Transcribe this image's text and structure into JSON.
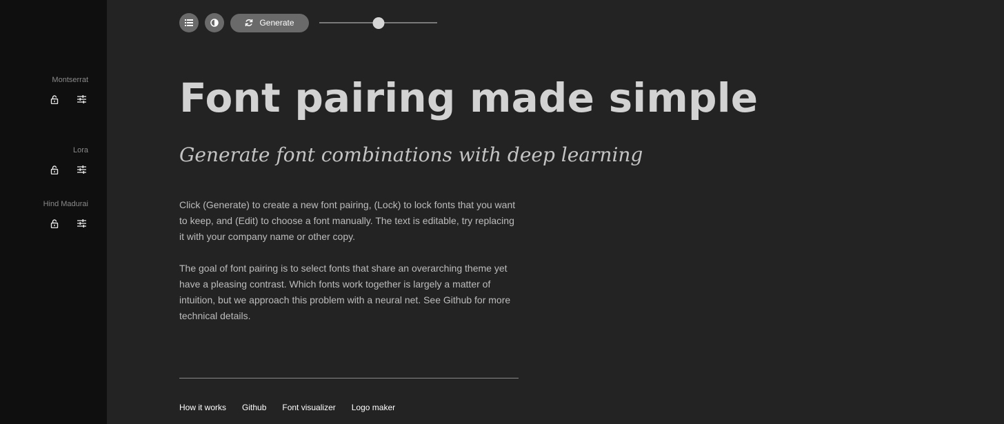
{
  "sidebar": {
    "fonts": [
      {
        "name": "Montserrat",
        "lock_icon": "lock-icon",
        "edit_icon": "sliders-icon"
      },
      {
        "name": "Lora",
        "lock_icon": "lock-icon",
        "edit_icon": "sliders-icon"
      },
      {
        "name": "Hind Madurai",
        "lock_icon": "lock-icon",
        "edit_icon": "sliders-icon"
      }
    ]
  },
  "toolbar": {
    "list_icon": "list-icon",
    "contrast_icon": "contrast-icon",
    "generate_label": "Generate",
    "generate_icon": "refresh-icon",
    "slider_value": 0.5
  },
  "main": {
    "headline": "Font pairing made simple",
    "subheadline": "Generate font combinations with deep learning",
    "paragraphs": [
      "Click (Generate) to create a new font pairing, (Lock) to lock fonts that you want to keep, and (Edit) to choose a font manually. The text is editable, try replacing it with your company name or other copy.",
      "The goal of font pairing is to select fonts that share an overarching theme yet have a pleasing contrast. Which fonts work together is largely a matter of intuition, but we approach this problem with a neural net. See Github for more technical details."
    ]
  },
  "footer": {
    "links": [
      "How it works",
      "Github",
      "Font visualizer",
      "Logo maker"
    ]
  },
  "colors": {
    "background": "#232323",
    "sidebar": "#0f0f0f",
    "button": "#6a6a6a",
    "text": "#d2d2d2"
  }
}
